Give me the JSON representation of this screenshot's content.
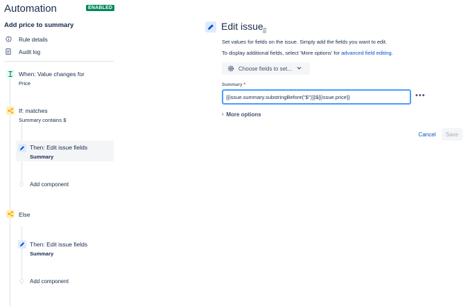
{
  "app": {
    "title": "Automation",
    "badge": "ENABLED"
  },
  "rule": {
    "name": "Add price to summary"
  },
  "menu": [
    {
      "label": "Rule details",
      "icon": "info-icon"
    },
    {
      "label": "Audit log",
      "icon": "document-icon"
    }
  ],
  "tree": {
    "trigger": {
      "title": "When: Value changes for",
      "sub": "Price",
      "icon": "trigger-icon"
    },
    "condition_if": {
      "title": "If: matches",
      "sub": "Summary contains $",
      "icon": "branch-icon"
    },
    "action_1": {
      "title": "Then: Edit issue fields",
      "sub": "Summary",
      "icon": "pencil-icon"
    },
    "add_component_1": "Add component",
    "condition_else": {
      "title": "Else",
      "icon": "branch-icon"
    },
    "action_2": {
      "title": "Then: Edit issue fields",
      "sub": "Summary",
      "icon": "pencil-icon"
    },
    "add_component_2": "Add component"
  },
  "editor": {
    "title": "Edit issue",
    "desc1": "Set values for fields on the issue. Simply add the fields you want to edit.",
    "desc2_prefix": "To display additional fields, select 'More options' for ",
    "desc2_link": "advanced field editing",
    "desc2_suffix": ".",
    "choose_button": "Choose fields to set...",
    "field_label": "Summary",
    "required_mark": "*",
    "summary_value": "{{issue.summary.substringBefore(\"$\")}}${{issue.price}}",
    "more_options": "More options",
    "cancel": "Cancel",
    "save": "Save"
  },
  "colors": {
    "enabled_badge": "#00875A",
    "link": "#0052CC",
    "input_focus": "#4C9AFF",
    "trigger_bg": "#E3FCEF",
    "condition_bg": "#FFF0B3",
    "action_bg": "#DEEBFF"
  }
}
